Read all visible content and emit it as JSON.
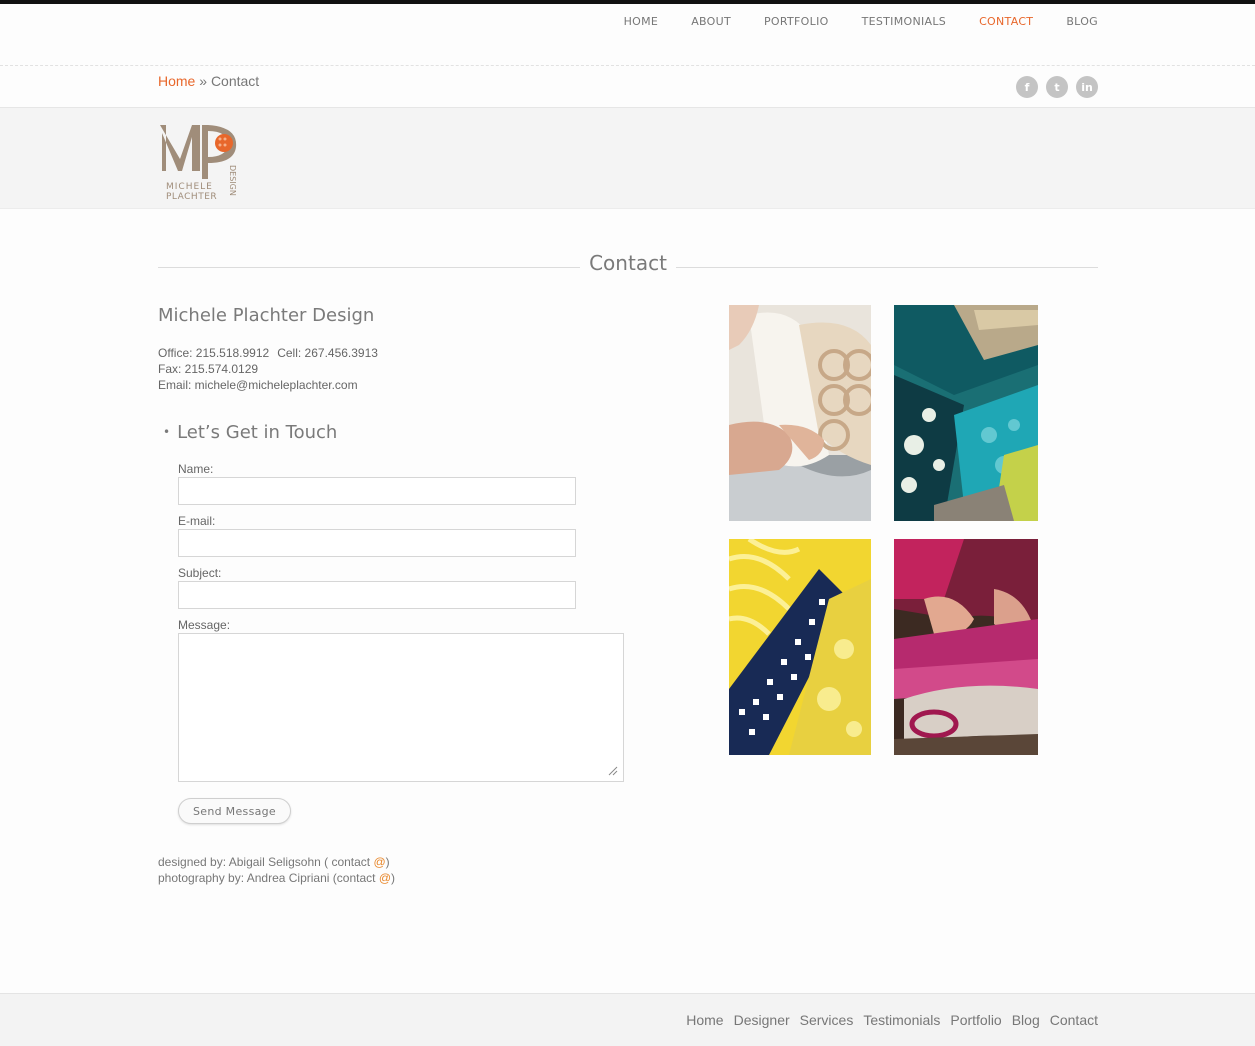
{
  "nav": {
    "items": [
      {
        "label": "HOME"
      },
      {
        "label": "ABOUT"
      },
      {
        "label": "PORTFOLIO"
      },
      {
        "label": "TESTIMONIALS"
      },
      {
        "label": "CONTACT",
        "active": true
      },
      {
        "label": "BLOG"
      }
    ]
  },
  "breadcrumb": {
    "home": "Home",
    "separator": "»",
    "current": "Contact"
  },
  "social": [
    {
      "name": "facebook-icon",
      "glyph": "f"
    },
    {
      "name": "twitter-icon",
      "glyph": "t"
    },
    {
      "name": "linkedin-icon",
      "glyph": "in"
    }
  ],
  "logo": {
    "name_line1": "MICHELE",
    "name_line2": "PLACHTER",
    "design": "DESIGN"
  },
  "page": {
    "title": "Contact",
    "company": "Michele Plachter Design",
    "office": "Office: 215.518.9912",
    "cell": "Cell: 267.456.3913",
    "fax": "Fax: 215.574.0129",
    "email": "Email: michele@micheleplachter.com"
  },
  "form": {
    "heading": "Let’s Get in Touch",
    "name_label": "Name:",
    "name_value": "",
    "email_label": "E-mail:",
    "email_value": "",
    "subject_label": "Subject:",
    "subject_value": "",
    "message_label": "Message:",
    "message_value": "",
    "send_label": "Send Message"
  },
  "credits": {
    "designer_text": "designed by: Abigail Seligsohn ( contact ",
    "designer_at": "@",
    "designer_close": ")",
    "photo_text": "photography by: Andrea Cipriani (contact ",
    "photo_at": "@",
    "photo_close": ")"
  },
  "footer": {
    "links": [
      "Home",
      "Designer",
      "Services",
      "Testimonials",
      "Portfolio",
      "Blog",
      "Contact"
    ]
  },
  "colors": {
    "accent": "#e8672b",
    "text": "#777777"
  }
}
